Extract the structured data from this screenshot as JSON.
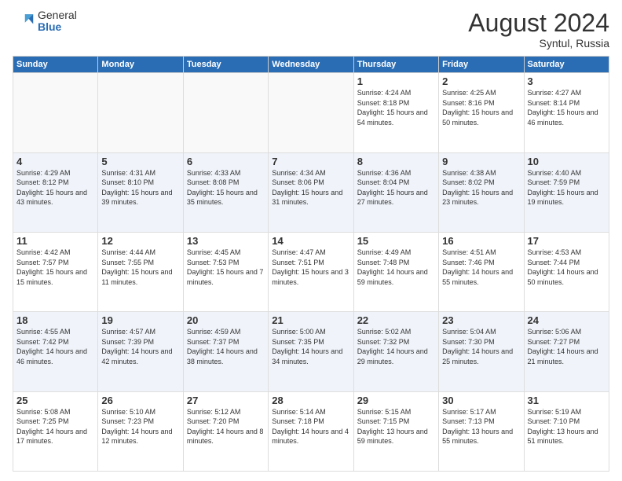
{
  "header": {
    "logo_general": "General",
    "logo_blue": "Blue",
    "month_title": "August 2024",
    "location": "Syntul, Russia"
  },
  "weekdays": [
    "Sunday",
    "Monday",
    "Tuesday",
    "Wednesday",
    "Thursday",
    "Friday",
    "Saturday"
  ],
  "weeks": [
    [
      {
        "day": "",
        "sunrise": "",
        "sunset": "",
        "daylight": ""
      },
      {
        "day": "",
        "sunrise": "",
        "sunset": "",
        "daylight": ""
      },
      {
        "day": "",
        "sunrise": "",
        "sunset": "",
        "daylight": ""
      },
      {
        "day": "",
        "sunrise": "",
        "sunset": "",
        "daylight": ""
      },
      {
        "day": "1",
        "sunrise": "Sunrise: 4:24 AM",
        "sunset": "Sunset: 8:18 PM",
        "daylight": "Daylight: 15 hours and 54 minutes."
      },
      {
        "day": "2",
        "sunrise": "Sunrise: 4:25 AM",
        "sunset": "Sunset: 8:16 PM",
        "daylight": "Daylight: 15 hours and 50 minutes."
      },
      {
        "day": "3",
        "sunrise": "Sunrise: 4:27 AM",
        "sunset": "Sunset: 8:14 PM",
        "daylight": "Daylight: 15 hours and 46 minutes."
      }
    ],
    [
      {
        "day": "4",
        "sunrise": "Sunrise: 4:29 AM",
        "sunset": "Sunset: 8:12 PM",
        "daylight": "Daylight: 15 hours and 43 minutes."
      },
      {
        "day": "5",
        "sunrise": "Sunrise: 4:31 AM",
        "sunset": "Sunset: 8:10 PM",
        "daylight": "Daylight: 15 hours and 39 minutes."
      },
      {
        "day": "6",
        "sunrise": "Sunrise: 4:33 AM",
        "sunset": "Sunset: 8:08 PM",
        "daylight": "Daylight: 15 hours and 35 minutes."
      },
      {
        "day": "7",
        "sunrise": "Sunrise: 4:34 AM",
        "sunset": "Sunset: 8:06 PM",
        "daylight": "Daylight: 15 hours and 31 minutes."
      },
      {
        "day": "8",
        "sunrise": "Sunrise: 4:36 AM",
        "sunset": "Sunset: 8:04 PM",
        "daylight": "Daylight: 15 hours and 27 minutes."
      },
      {
        "day": "9",
        "sunrise": "Sunrise: 4:38 AM",
        "sunset": "Sunset: 8:02 PM",
        "daylight": "Daylight: 15 hours and 23 minutes."
      },
      {
        "day": "10",
        "sunrise": "Sunrise: 4:40 AM",
        "sunset": "Sunset: 7:59 PM",
        "daylight": "Daylight: 15 hours and 19 minutes."
      }
    ],
    [
      {
        "day": "11",
        "sunrise": "Sunrise: 4:42 AM",
        "sunset": "Sunset: 7:57 PM",
        "daylight": "Daylight: 15 hours and 15 minutes."
      },
      {
        "day": "12",
        "sunrise": "Sunrise: 4:44 AM",
        "sunset": "Sunset: 7:55 PM",
        "daylight": "Daylight: 15 hours and 11 minutes."
      },
      {
        "day": "13",
        "sunrise": "Sunrise: 4:45 AM",
        "sunset": "Sunset: 7:53 PM",
        "daylight": "Daylight: 15 hours and 7 minutes."
      },
      {
        "day": "14",
        "sunrise": "Sunrise: 4:47 AM",
        "sunset": "Sunset: 7:51 PM",
        "daylight": "Daylight: 15 hours and 3 minutes."
      },
      {
        "day": "15",
        "sunrise": "Sunrise: 4:49 AM",
        "sunset": "Sunset: 7:48 PM",
        "daylight": "Daylight: 14 hours and 59 minutes."
      },
      {
        "day": "16",
        "sunrise": "Sunrise: 4:51 AM",
        "sunset": "Sunset: 7:46 PM",
        "daylight": "Daylight: 14 hours and 55 minutes."
      },
      {
        "day": "17",
        "sunrise": "Sunrise: 4:53 AM",
        "sunset": "Sunset: 7:44 PM",
        "daylight": "Daylight: 14 hours and 50 minutes."
      }
    ],
    [
      {
        "day": "18",
        "sunrise": "Sunrise: 4:55 AM",
        "sunset": "Sunset: 7:42 PM",
        "daylight": "Daylight: 14 hours and 46 minutes."
      },
      {
        "day": "19",
        "sunrise": "Sunrise: 4:57 AM",
        "sunset": "Sunset: 7:39 PM",
        "daylight": "Daylight: 14 hours and 42 minutes."
      },
      {
        "day": "20",
        "sunrise": "Sunrise: 4:59 AM",
        "sunset": "Sunset: 7:37 PM",
        "daylight": "Daylight: 14 hours and 38 minutes."
      },
      {
        "day": "21",
        "sunrise": "Sunrise: 5:00 AM",
        "sunset": "Sunset: 7:35 PM",
        "daylight": "Daylight: 14 hours and 34 minutes."
      },
      {
        "day": "22",
        "sunrise": "Sunrise: 5:02 AM",
        "sunset": "Sunset: 7:32 PM",
        "daylight": "Daylight: 14 hours and 29 minutes."
      },
      {
        "day": "23",
        "sunrise": "Sunrise: 5:04 AM",
        "sunset": "Sunset: 7:30 PM",
        "daylight": "Daylight: 14 hours and 25 minutes."
      },
      {
        "day": "24",
        "sunrise": "Sunrise: 5:06 AM",
        "sunset": "Sunset: 7:27 PM",
        "daylight": "Daylight: 14 hours and 21 minutes."
      }
    ],
    [
      {
        "day": "25",
        "sunrise": "Sunrise: 5:08 AM",
        "sunset": "Sunset: 7:25 PM",
        "daylight": "Daylight: 14 hours and 17 minutes."
      },
      {
        "day": "26",
        "sunrise": "Sunrise: 5:10 AM",
        "sunset": "Sunset: 7:23 PM",
        "daylight": "Daylight: 14 hours and 12 minutes."
      },
      {
        "day": "27",
        "sunrise": "Sunrise: 5:12 AM",
        "sunset": "Sunset: 7:20 PM",
        "daylight": "Daylight: 14 hours and 8 minutes."
      },
      {
        "day": "28",
        "sunrise": "Sunrise: 5:14 AM",
        "sunset": "Sunset: 7:18 PM",
        "daylight": "Daylight: 14 hours and 4 minutes."
      },
      {
        "day": "29",
        "sunrise": "Sunrise: 5:15 AM",
        "sunset": "Sunset: 7:15 PM",
        "daylight": "Daylight: 13 hours and 59 minutes."
      },
      {
        "day": "30",
        "sunrise": "Sunrise: 5:17 AM",
        "sunset": "Sunset: 7:13 PM",
        "daylight": "Daylight: 13 hours and 55 minutes."
      },
      {
        "day": "31",
        "sunrise": "Sunrise: 5:19 AM",
        "sunset": "Sunset: 7:10 PM",
        "daylight": "Daylight: 13 hours and 51 minutes."
      }
    ]
  ]
}
